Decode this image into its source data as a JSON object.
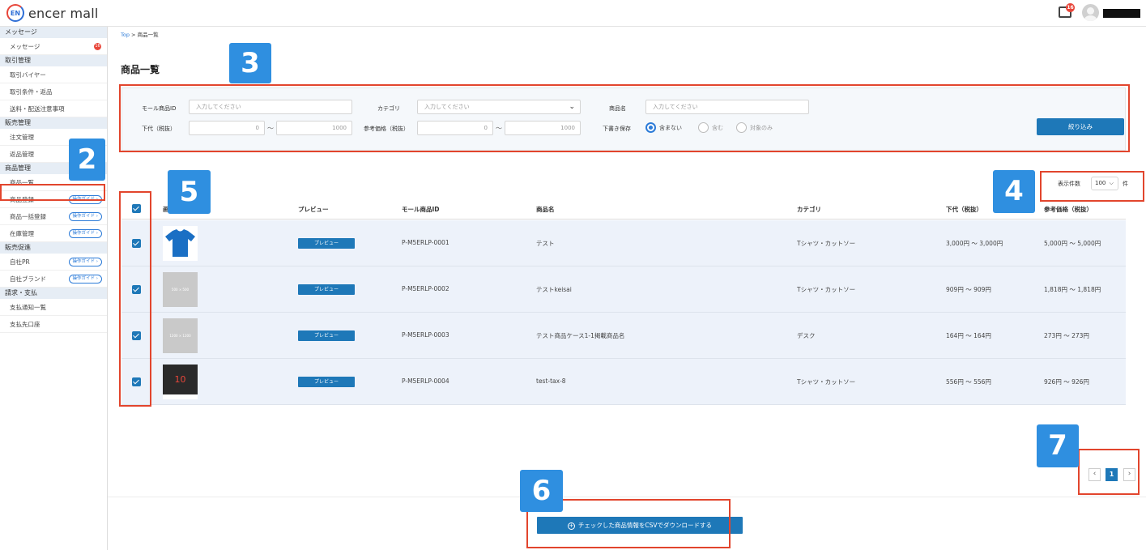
{
  "header": {
    "brand": "encer mall",
    "logo_mark": "EN",
    "message_count": "16",
    "icons": {
      "message": "message-icon",
      "avatar": "avatar-icon"
    }
  },
  "sidebar": {
    "groups": [
      {
        "title": "メッセージ",
        "items": [
          {
            "label": "メッセージ",
            "badge": "16"
          }
        ]
      },
      {
        "title": "取引管理",
        "items": [
          {
            "label": "取引バイヤー"
          },
          {
            "label": "取引条件・返品"
          },
          {
            "label": "送料・配送注意事項"
          }
        ]
      },
      {
        "title": "販売管理",
        "items": [
          {
            "label": "注文管理"
          },
          {
            "label": "返品管理"
          }
        ]
      },
      {
        "title": "商品管理",
        "items": [
          {
            "label": "商品一覧"
          },
          {
            "label": "商品登録",
            "guide": "操作ガイド"
          },
          {
            "label": "商品一括登録",
            "guide": "操作ガイド"
          },
          {
            "label": "在庫管理",
            "guide": "操作ガイド"
          }
        ]
      },
      {
        "title": "販売促進",
        "items": [
          {
            "label": "自社PR",
            "guide": "操作ガイド"
          },
          {
            "label": "自社ブランド",
            "guide": "操作ガイド"
          }
        ]
      },
      {
        "title": "請求・支払",
        "items": [
          {
            "label": "支払通知一覧"
          },
          {
            "label": "支払先口座"
          }
        ]
      }
    ]
  },
  "breadcrumb": {
    "top": "Top",
    "sep": ">",
    "current": "商品一覧"
  },
  "page_title": "商品一覧",
  "filter": {
    "mall_id_label": "モール商品ID",
    "mall_id_placeholder": "入力してください",
    "category_label": "カテゴリ",
    "category_placeholder": "入力してください",
    "name_label": "商品名",
    "name_placeholder": "入力してください",
    "wholesale_label": "下代（税抜）",
    "wholesale_min": "0",
    "wholesale_max": "1000",
    "ref_price_label": "参考価格（税抜）",
    "ref_min": "0",
    "ref_max": "1000",
    "tilde": "〜",
    "draft_label": "下書き保存",
    "draft_options": [
      "含まない",
      "含む",
      "対象のみ"
    ],
    "draft_selected": "含まない",
    "submit": "絞り込み"
  },
  "per_page": {
    "label": "表示件数",
    "value": "100",
    "unit": "件"
  },
  "table": {
    "headers": {
      "image": "画像",
      "preview": "プレビュー",
      "mall_id": "モール商品ID",
      "name": "商品名",
      "category": "カテゴリ",
      "wholesale": "下代（税抜）",
      "ref_price": "参考価格（税抜）"
    },
    "rows": [
      {
        "thumb_text": "",
        "preview": "プレビュー",
        "mall_id": "P-M5ERLP-0001",
        "name": "テスト",
        "category": "Tシャツ・カットソー",
        "wholesale": "3,000円 〜 3,000円",
        "ref_price": "5,000円 〜 5,000円"
      },
      {
        "thumb_text": "500 × 500",
        "preview": "プレビュー",
        "mall_id": "P-M5ERLP-0002",
        "name": "テストkeisai",
        "category": "Tシャツ・カットソー",
        "wholesale": "909円 〜 909円",
        "ref_price": "1,818円 〜 1,818円"
      },
      {
        "thumb_text": "1200 × 1200",
        "preview": "プレビュー",
        "mall_id": "P-M5ERLP-0003",
        "name": "テスト商品ケース1-1掲載商品名",
        "category": "デスク",
        "wholesale": "164円 〜 164円",
        "ref_price": "273円 〜 273円"
      },
      {
        "thumb_text": "10",
        "preview": "プレビュー",
        "mall_id": "P-M5ERLP-0004",
        "name": "test-tax-8",
        "category": "Tシャツ・カットソー",
        "wholesale": "556円 〜 556円",
        "ref_price": "926円 〜 926円"
      }
    ]
  },
  "pagination": {
    "prev": "‹",
    "current": "1",
    "next": "›"
  },
  "csv_button": "チェックした商品情報をCSVでダウンロードする",
  "annotations": [
    "2",
    "3",
    "4",
    "5",
    "6",
    "7"
  ],
  "colors": {
    "accent": "#1e78b8",
    "annotation_box": "#e2452d",
    "annotation_badge": "#2f8fe0",
    "row_bg": "#edf2fa"
  }
}
